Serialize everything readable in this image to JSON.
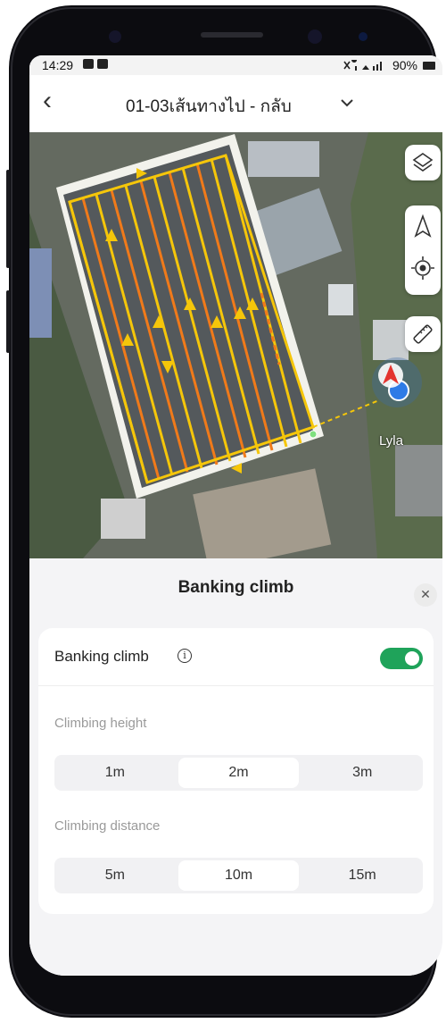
{
  "status_bar": {
    "time": "14:29",
    "battery": "90%"
  },
  "header": {
    "title": "01-03เส้นทางไป - กลับ"
  },
  "map": {
    "pilot_name": "Lyla"
  },
  "sheet": {
    "title": "Banking climb",
    "toggle_label": "Banking climb",
    "toggle_on": true,
    "height_label": "Climbing height",
    "height_options": [
      "1m",
      "2m",
      "3m"
    ],
    "height_selected": "2m",
    "distance_label": "Climbing distance",
    "distance_options": [
      "5m",
      "10m",
      "15m"
    ],
    "distance_selected": "10m"
  },
  "colors": {
    "accent_green": "#1fa35a",
    "route_yellow": "#f5c60a",
    "route_orange": "#f07a1a"
  },
  "icons": [
    "back-icon",
    "chevron-down-icon",
    "layers-icon",
    "navigation-arrow-icon",
    "locate-icon",
    "ruler-icon",
    "info-icon",
    "close-icon"
  ]
}
